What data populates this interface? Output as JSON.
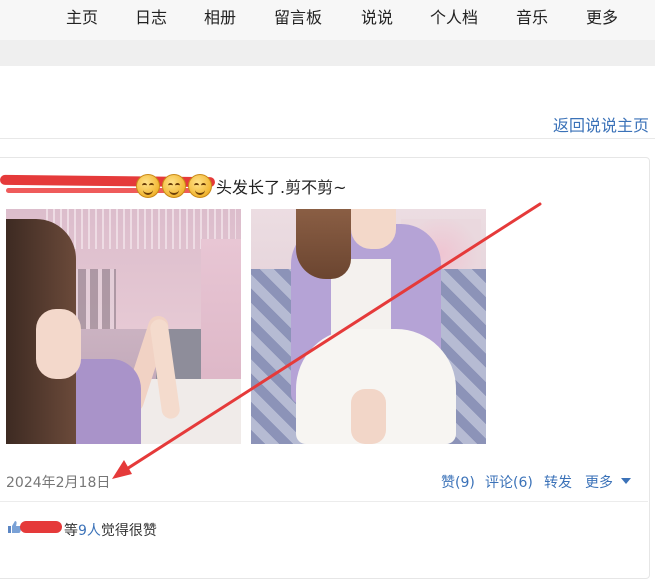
{
  "nav": {
    "items": [
      "主页",
      "日志",
      "相册",
      "留言板",
      "说说",
      "个人档",
      "音乐",
      "更多"
    ]
  },
  "back_link": "返回说说主页",
  "post": {
    "text": "头发长了.剪不剪~",
    "date": "2024年2月18日",
    "actions": {
      "like": "赞(9)",
      "comment": "评论(6)",
      "repost": "转发",
      "more": "更多"
    },
    "likes": {
      "prefix": "等",
      "count": "9人",
      "suffix": "觉得很赞"
    }
  },
  "colors": {
    "link": "#3b72b8",
    "annotation": "#e53a3a"
  }
}
